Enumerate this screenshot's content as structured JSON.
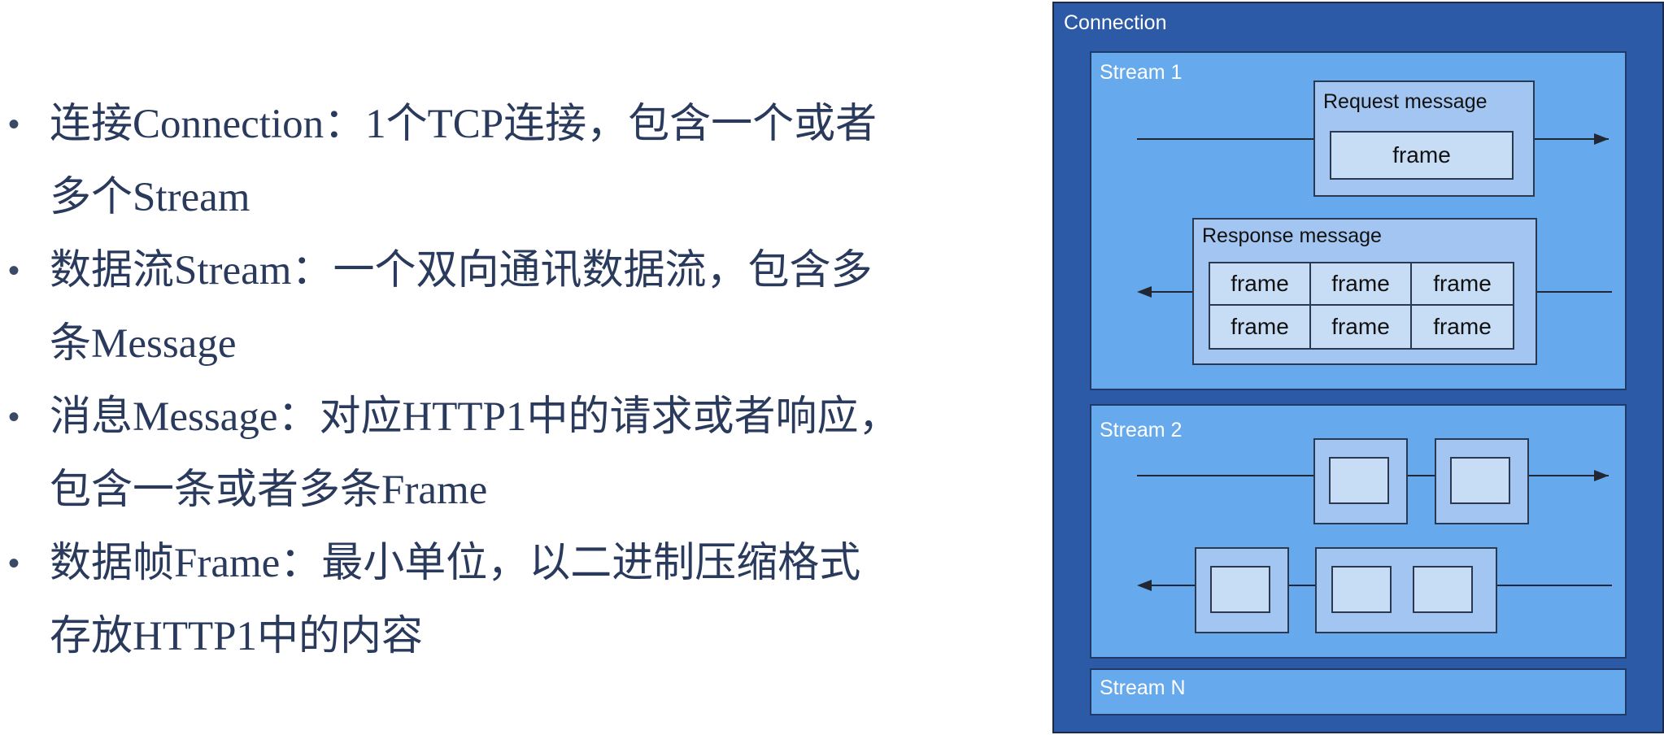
{
  "bullets": [
    {
      "line1": "连接Connection：1个TCP连接，包含一个或者",
      "line2": "多个Stream"
    },
    {
      "line1": "数据流Stream：一个双向通讯数据流，包含多",
      "line2": "条Message"
    },
    {
      "line1": "消息Message：对应HTTP1中的请求或者响应，",
      "line2": "包含一条或者多条Frame"
    },
    {
      "line1": "数据帧Frame：最小单位，以二进制压缩格式",
      "line2": "存放HTTP1中的内容"
    }
  ],
  "bullet_symbol": "•",
  "diagram": {
    "connection_label": "Connection",
    "stream1": {
      "label": "Stream 1",
      "request": {
        "label": "Request message",
        "frame": "frame"
      },
      "response": {
        "label": "Response message",
        "frames": [
          "frame",
          "frame",
          "frame",
          "frame",
          "frame",
          "frame"
        ]
      }
    },
    "stream2": {
      "label": "Stream 2"
    },
    "streamN": {
      "label": "Stream N"
    }
  },
  "colors": {
    "connection": "#2d5aa6",
    "stream": "#66a9ec",
    "message": "#a2c6f1",
    "frame": "#c7dcf5",
    "text": "#2a3a5c"
  }
}
